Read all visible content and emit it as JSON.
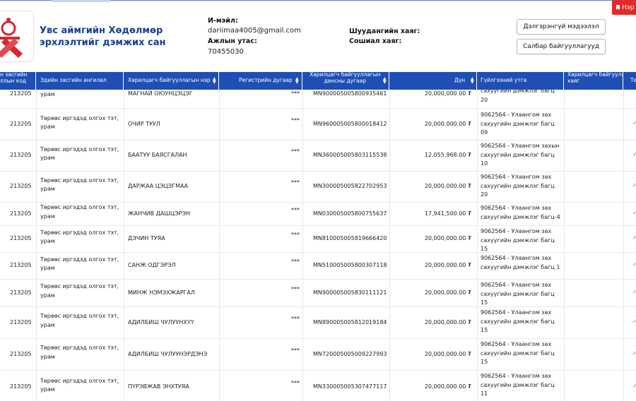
{
  "header": {
    "org_name": "Увс аймгийн Хөдөлмөр эрхлэлтийг дэмжих сан",
    "email_label": "И-мэйл:",
    "email": "dariimaa4005@gmail.com",
    "phone_label": "Ажлын утас:",
    "phone": "70455030",
    "address_label": "Шуудангийн хаяг:",
    "social_label": "Сошиал хаяг:",
    "btn_details": "Дэлгэрэнгүй мэдээлэл",
    "btn_branches": "Салбар байгууллагууд",
    "red_tab": "Нэр"
  },
  "table": {
    "columns": [
      "н засгийн\nллын код",
      "Эдийн засгийн ангилал",
      "Харилцагч байгууллагын нэр",
      "Регистрийн дугаар",
      "Харилцагч байгууллагын\nдансны дугаар",
      "Дүн",
      "Гүйлгээний утга",
      "Харилцагч байгууллагын\nхаяг",
      "Те"
    ],
    "rows": [
      {
        "code": "213205",
        "cat": "урам",
        "name": "МАГНАЙ ОЮУНЦЭЦЭГ",
        "reg": "***",
        "acct": "MN900005005800935461",
        "amt": "20,000,000.00 ₮",
        "desc": "сахуугийн дэмжлэг багц\n20",
        "addr": ""
      },
      {
        "code": "213205",
        "cat": "Төрөөс иргэдэд олгох тэт,\nурам",
        "name": "ОЧИР ТУУЛ",
        "reg": "***",
        "acct": "MN960005005800018412",
        "amt": "20,000,000.00 ₮",
        "desc": "9062564 - Улаангом зах\nсахуугийн дэмжлэг багц\n09",
        "addr": ""
      },
      {
        "code": "213205",
        "cat": "Төрөөс иргэдэд олгох тэт,\nурам",
        "name": "БААТУУ БАЯСГАЛАН",
        "reg": "***",
        "acct": "MN360005005803115538",
        "amt": "12,055,968.00 ₮",
        "desc": "9062564 - Улаангом захын\nсахуугийн дэмжлэг багц\n10",
        "addr": ""
      },
      {
        "code": "213205",
        "cat": "Төрөөс иргэдэд олгох тэт,\nурам",
        "name": "ДАРЖАА ЦЭЦЭГМАА",
        "reg": "***",
        "acct": "MN300005005822702953",
        "amt": "20,000,000.00 ₮",
        "desc": "9062564 - Улаангом зах\nсахуугийн дэмжлэг багц\n20",
        "addr": ""
      },
      {
        "code": "213205",
        "cat": "Төрөөс иргэдэд олгох тэт,\nурам",
        "name": "ЖАНЧИВ ДАШЦЭРЭН",
        "reg": "***",
        "acct": "MN030005005800755637",
        "amt": "17,941,500.00 ₮",
        "desc": "9062564 - Улаангом зах\nсахуугийн дэмжлэг багц-4",
        "addr": ""
      },
      {
        "code": "213205",
        "cat": "Төрөөс иргэдэд олгох тэт,\nурам",
        "name": "ДЭЧИН ТУЯА",
        "reg": "***",
        "acct": "MN810005005819666420",
        "amt": "20,000,000.00 ₮",
        "desc": "9062564 - Улаангом зах\nсахуугийн дэмжлэг багц\n15",
        "addr": ""
      },
      {
        "code": "213205",
        "cat": "Төрөөс иргэдэд олгох тэт,\nурам",
        "name": "САНЖ ОДГЭРЭЛ",
        "reg": "***",
        "acct": "MN510005005800307118",
        "amt": "20,000,000.00 ₮",
        "desc": "9062564 - Улаангом зах\nсахуугийн дэмжлэг багц 1",
        "addr": ""
      },
      {
        "code": "213205",
        "cat": "Төрөөс иргэдэд олгох тэт,\nурам",
        "name": "МИНЖ НЭМЭХЖАРГАЛ",
        "reg": "***",
        "acct": "MN900005005830111121",
        "amt": "20,000,000.00 ₮",
        "desc": "9062564 - Улаангом зах\nсахуугийн дэмжлэг багц\n15",
        "addr": ""
      },
      {
        "code": "213205",
        "cat": "Төрөөс иргэдэд олгох тэт,\nурам",
        "name": "АДИЛБИШ ЧУЛУУНХҮҮ",
        "reg": "***",
        "acct": "MN890005005812019184",
        "amt": "20,000,000.00 ₮",
        "desc": "9062564 - Улаангом зах\nсахуугийн дэмжлэг багц\n15",
        "addr": ""
      },
      {
        "code": "213205",
        "cat": "Төрөөс иргэдэд олгох тэт,\nурам",
        "name": "АДИЛБИШ ЧУЛУУНЭРДЭНЭ",
        "reg": "***",
        "acct": "MN720005005009227993",
        "amt": "20,000,000.00 ₮",
        "desc": "9062564 - Улаангом зах\nсахуугийн дэмжлэг багц\n15",
        "addr": ""
      },
      {
        "code": "213205",
        "cat": "Төрөөс иргэдэд олгох тэт,\nурам",
        "name": "ПҮРЭВЖАВ ЭНХТУЯА",
        "reg": "***",
        "acct": "MN330005005307477117",
        "amt": "20,000,000.00 ₮",
        "desc": "9062564 - Улаангом зах\nсахуугийн дэмжлэг багц\n11",
        "addr": ""
      }
    ]
  },
  "colors": {
    "header_blue": "#1f4fb4",
    "org_name": "#1d3f8c",
    "red_tab": "#e32a2a",
    "check_green": "#2bb673"
  }
}
